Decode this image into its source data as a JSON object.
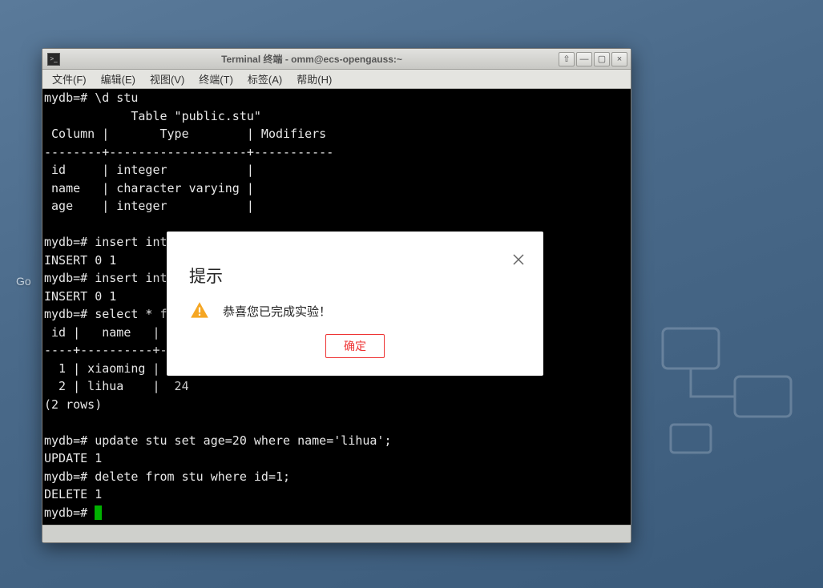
{
  "window": {
    "title": "Terminal 终端 - omm@ecs-opengauss:~",
    "controls": {
      "pin": "⇧",
      "min": "—",
      "max": "▢",
      "close": "×"
    }
  },
  "menu": {
    "file": "文件(F)",
    "edit": "编辑(E)",
    "view": "视图(V)",
    "terminal": "终端(T)",
    "tabs": "标签(A)",
    "help": "帮助(H)"
  },
  "terminal": {
    "content": "mydb=# \\d stu\n            Table \"public.stu\"\n Column |       Type        | Modifiers\n--------+-------------------+-----------\n id     | integer           |\n name   | character varying |\n age    | integer           |\n\nmydb=# insert int\nINSERT 0 1\nmydb=# insert int\nINSERT 0 1\nmydb=# select * f\n id |   name   |\n----+----------+-\n  1 | xiaoming |  18\n  2 | lihua    |  24\n(2 rows)\n\nmydb=# update stu set age=20 where name='lihua';\nUPDATE 1\nmydb=# delete from stu where id=1;\nDELETE 1\nmydb=# "
  },
  "dialog": {
    "title": "提示",
    "message": "恭喜您已完成实验！",
    "ok": "确定"
  },
  "desktop": {
    "go": "Go"
  }
}
